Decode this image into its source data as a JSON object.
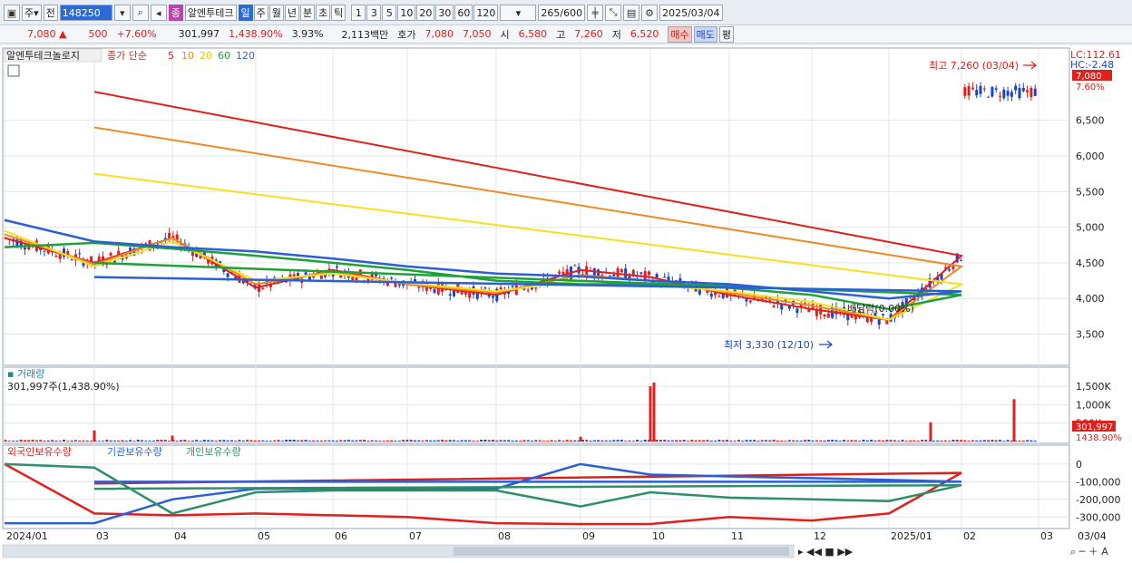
{
  "toolbar": {
    "type_label": "주",
    "prev_label": "전",
    "code": "148250",
    "name_badge": "종",
    "name": "알엔투테크",
    "periods": [
      "일",
      "주",
      "월",
      "년",
      "분",
      "초",
      "틱"
    ],
    "intervals": [
      "1",
      "3",
      "5",
      "10",
      "20",
      "30",
      "60",
      "120"
    ],
    "count": "265",
    "count_total": "/600",
    "date": "2025/03/04"
  },
  "quote": {
    "price": "7,080",
    "change": "500",
    "change_pct": "+7.60%",
    "volume": "301,997",
    "volume_pct": "1,438.90%",
    "turnover_pct": "3.93%",
    "amount": "2,113백만",
    "hoga_label": "호가",
    "ask": "7,080",
    "bid": "7,050",
    "open_label": "시",
    "open": "6,580",
    "high_label": "고",
    "high": "7,260",
    "low_label": "저",
    "low": "6,520",
    "buy_label": "매수",
    "sell_label": "매도",
    "eval_label": "평"
  },
  "price_panel": {
    "stock_name": "알엔투테크놀로지",
    "ma_label": "종가 단순",
    "ma_periods": [
      "5",
      "10",
      "20",
      "60",
      "120"
    ],
    "lc": "LC:112.61",
    "hc": "HC:-2.48",
    "last_tag": "7,080",
    "last_pct": "7.60%",
    "high_note": "최고 7,260 (03/04)",
    "low_note": "최저 3,330 (12/10)",
    "dividend_note": "배당락(0.00%)"
  },
  "volume_panel": {
    "title": "거래량",
    "value": "301,997주(1,438.90%)",
    "last_tag": "301,997",
    "last_pct": "1438.90%"
  },
  "holdings_panel": {
    "series": [
      "외국인보유수량",
      "기관보유수량",
      "개인보유수량"
    ]
  },
  "x_labels": [
    "2024/01",
    "03",
    "04",
    "05",
    "06",
    "07",
    "08",
    "09",
    "10",
    "11",
    "12",
    "2025/01",
    "02",
    "03",
    "03/04"
  ],
  "colors": {
    "up": "#e0201c",
    "down": "#1a43c8",
    "ma5": "#e0201c",
    "ma10": "#f08a24",
    "ma20": "#f5e020",
    "ma60": "#1ea03a",
    "ma120": "#2a5fd6",
    "foreign": "#e0201c",
    "institution": "#2a5fd6",
    "individual": "#2f8f6a"
  },
  "chart_data": [
    {
      "type": "candlestick",
      "title": "알엔투테크놀로지",
      "y_ticks": [
        3500,
        4000,
        4500,
        5000,
        5500,
        6000,
        6500
      ],
      "ylim": [
        3100,
        7450
      ],
      "series": [
        {
          "name": "5",
          "x": [
            "2024/01",
            "03",
            "04",
            "05",
            "06",
            "07",
            "08",
            "09",
            "10",
            "11",
            "12",
            "2025/01",
            "02",
            "03"
          ],
          "y": [
            4850,
            4500,
            4850,
            4150,
            4400,
            4200,
            4050,
            4400,
            4300,
            4050,
            3850,
            3700,
            4600,
            6900
          ]
        },
        {
          "name": "10",
          "x": [
            "2024/01",
            "03",
            "04",
            "05",
            "06",
            "07",
            "08",
            "09",
            "10",
            "11",
            "12",
            "2025/01",
            "02",
            "03"
          ],
          "y": [
            4900,
            4480,
            4850,
            4200,
            4380,
            4200,
            4080,
            4330,
            4250,
            4080,
            3900,
            3700,
            4450,
            6400
          ]
        },
        {
          "name": "20",
          "x": [
            "2024/01",
            "03",
            "04",
            "05",
            "06",
            "07",
            "08",
            "09",
            "10",
            "11",
            "12",
            "2025/01",
            "02",
            "03"
          ],
          "y": [
            4950,
            4450,
            4800,
            4250,
            4350,
            4220,
            4100,
            4250,
            4200,
            4100,
            3950,
            3700,
            4200,
            5750
          ]
        },
        {
          "name": "60",
          "x": [
            "2024/01",
            "03",
            "04",
            "05",
            "06",
            "07",
            "08",
            "09",
            "10",
            "11",
            "12",
            "2025/01",
            "02",
            "03"
          ],
          "y": [
            4720,
            4780,
            4700,
            4600,
            4500,
            4400,
            4250,
            4200,
            4200,
            4150,
            4050,
            3850,
            4050,
            4500
          ]
        },
        {
          "name": "120",
          "x": [
            "2024/01",
            "03",
            "04",
            "05",
            "06",
            "07",
            "08",
            "09",
            "10",
            "11",
            "12",
            "2025/01",
            "02",
            "03"
          ],
          "y": [
            5100,
            4800,
            4720,
            4660,
            4560,
            4450,
            4350,
            4310,
            4250,
            4200,
            4100,
            4000,
            4100,
            4300
          ]
        }
      ],
      "annotations": {
        "high": 7260,
        "high_date": "03/04",
        "low": 3330,
        "low_date": "12/10"
      }
    },
    {
      "type": "bar",
      "title": "거래량",
      "y_ticks_labels": [
        "500K",
        "1,000K",
        "1,500K"
      ],
      "y_ticks": [
        500000,
        1000000,
        1500000
      ],
      "ylim": [
        0,
        1650000
      ],
      "values_note": "daily volume",
      "spikes": [
        {
          "x": "04",
          "value": 160000
        },
        {
          "x": "09",
          "value": 130000
        },
        {
          "x": "10",
          "value": 1500000
        },
        {
          "x": "10",
          "value": 1600000
        },
        {
          "x": "2025/01",
          "value": 520000
        },
        {
          "x": "02",
          "value": 1150000
        },
        {
          "x": "03",
          "value": 301997
        }
      ]
    },
    {
      "type": "line",
      "title": "외국인보유수량 기관보유수량 개인보유수량",
      "y_ticks": [
        0,
        -100000,
        -200000,
        -300000
      ],
      "ylim": [
        -350000,
        30000
      ],
      "x": [
        "2024/01",
        "03",
        "04",
        "05",
        "06",
        "07",
        "08",
        "09",
        "10",
        "11",
        "12",
        "2025/01",
        "02",
        "03"
      ],
      "series": [
        {
          "name": "외국인보유수량",
          "values": [
            0,
            -280000,
            -290000,
            -280000,
            -290000,
            -300000,
            -335000,
            -340000,
            -340000,
            -300000,
            -320000,
            -280000,
            -50000,
            -110000
          ]
        },
        {
          "name": "기관보유수량",
          "values": [
            -335000,
            -335000,
            -200000,
            -140000,
            -140000,
            -140000,
            -140000,
            0,
            -60000,
            -70000,
            -80000,
            -90000,
            -100000,
            -100000
          ]
        },
        {
          "name": "개인보유수량",
          "values": [
            0,
            -20000,
            -280000,
            -160000,
            -150000,
            -150000,
            -150000,
            -240000,
            -160000,
            -190000,
            -200000,
            -210000,
            -120000,
            -140000
          ]
        }
      ]
    }
  ]
}
